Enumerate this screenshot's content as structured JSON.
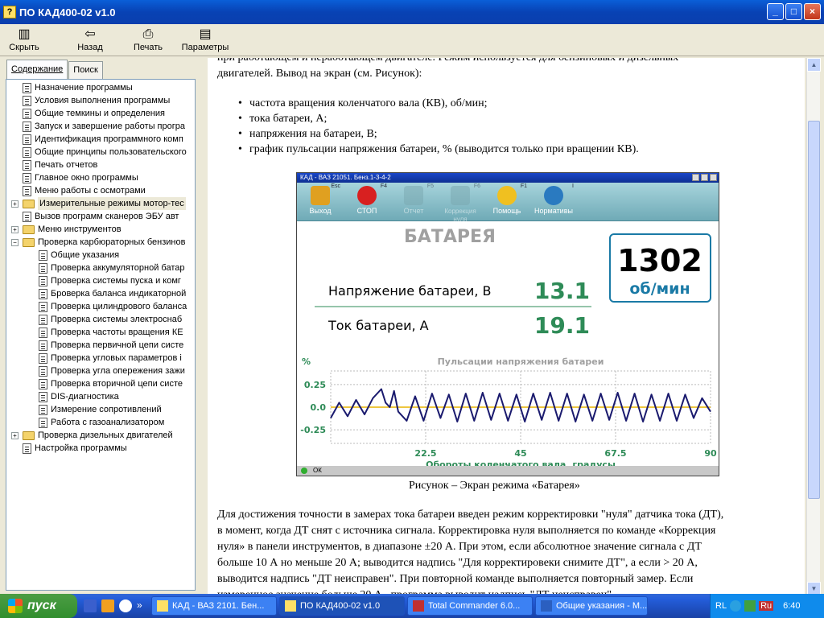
{
  "window": {
    "title": "ПО КАД400-02 v1.0",
    "controls": {
      "minimize": "_",
      "maximize": "□",
      "close": "×"
    }
  },
  "toolbar": [
    {
      "label": "Скрыть",
      "icon": "hide-icon"
    },
    {
      "label": "Назад",
      "icon": "back-arrow-icon"
    },
    {
      "label": "Печать",
      "icon": "printer-icon"
    },
    {
      "label": "Параметры",
      "icon": "options-icon"
    }
  ],
  "nav_tabs": [
    "Содержание",
    "Поиск"
  ],
  "tree": [
    {
      "label": "Назначение программы",
      "type": "doc",
      "level": 1
    },
    {
      "label": "Условия выполнения программы",
      "type": "doc",
      "level": 1
    },
    {
      "label": "Общие темкины и определения",
      "type": "doc",
      "level": 1
    },
    {
      "label": "Запуск и завершение работы програ",
      "type": "doc",
      "level": 1
    },
    {
      "label": "Идентификация программного комп",
      "type": "doc",
      "level": 1
    },
    {
      "label": "Общие принципы пользовательского",
      "type": "doc",
      "level": 1
    },
    {
      "label": "Печать отчетов",
      "type": "doc",
      "level": 1
    },
    {
      "label": "Главное окно программы",
      "type": "doc",
      "level": 1
    },
    {
      "label": "Меню работы с осмотрами",
      "type": "doc",
      "level": 1
    },
    {
      "label": "Измерительные режимы мотор-тес",
      "type": "folder",
      "level": 0,
      "toggle": "+",
      "highlight": true
    },
    {
      "label": "Вызов программ сканеров ЭБУ авт",
      "type": "doc",
      "level": 1
    },
    {
      "label": "Меню инструментов",
      "type": "folder",
      "level": 0,
      "toggle": "+"
    },
    {
      "label": "Проверка карбюраторных бензинов",
      "type": "folder-open",
      "level": 0,
      "toggle": "−"
    },
    {
      "label": "Общие указания",
      "type": "doc",
      "level": 2
    },
    {
      "label": "Проверка аккумуляторной батар",
      "type": "doc",
      "level": 2
    },
    {
      "label": "Проверка системы пуска и комг",
      "type": "doc",
      "level": 2
    },
    {
      "label": "Броверка баланса индикаторной",
      "type": "doc",
      "level": 2
    },
    {
      "label": "Проверка цилиндрового баланса",
      "type": "doc",
      "level": 2
    },
    {
      "label": "Проверка системы электроснаб",
      "type": "doc",
      "level": 2
    },
    {
      "label": "Проверка частоты вращения КЕ",
      "type": "doc",
      "level": 2
    },
    {
      "label": "Проверка первичной цепи систе",
      "type": "doc",
      "level": 2
    },
    {
      "label": "Проверка угловых параметров і",
      "type": "doc",
      "level": 2
    },
    {
      "label": "Проверка угла опережения зажи",
      "type": "doc",
      "level": 2
    },
    {
      "label": "Проверка вторичной цепи систе",
      "type": "doc",
      "level": 2
    },
    {
      "label": "DIS-диагностика",
      "type": "doc",
      "level": 2
    },
    {
      "label": "Измерение сопротивлений",
      "type": "doc",
      "level": 2
    },
    {
      "label": "Работа с газоанализатором",
      "type": "doc",
      "level": 2
    },
    {
      "label": "Проверка дизельных двигателей",
      "type": "folder",
      "level": 0,
      "toggle": "+"
    },
    {
      "label": "Настройка программы",
      "type": "doc",
      "level": 1
    }
  ],
  "content": {
    "intro_line1": "при работающем и неработающем двигателе. Режим используется для бензиновых и дизельных",
    "intro_line2": "двигателей. Вывод на экран (см. Рисунок):",
    "bullets": [
      "частота вращения коленчатого вала (КВ), об/мин;",
      "тока батареи, А;",
      "напряжения на батареи, В;",
      "график пульсации напряжения батареи, % (выводится только при вращении КВ)."
    ],
    "caption": "Рисунок – Экран режима «Батарея»",
    "para": [
      "Для достижения точности в замерах тока батареи введен режим корректировки \"нуля\" датчика тока (ДТ),",
      "в момент, когда ДТ снят с источника сигнала. Корректировка нуля выполняется по команде «Коррекция",
      "нуля» в панели инструментов, в диапазоне ±20 А. При этом, если абсолютное значение сигнала с ДТ",
      "больше 10 А но меньше 20 А; выводится надпись \"Для корректировеки снимите ДТ\", а если > 20 А,",
      "выводится надпись \"ДТ неисправен\". При повторной команде выполняется повторный замер. Если",
      "измеренное значение больше 20 А , программа выводит надпись \"ДТ неисправен\"."
    ]
  },
  "figure": {
    "title": "КАД - ВАЗ 21051. Бенз.1-3-4-2",
    "buttons": [
      {
        "label": "Выход",
        "key": "Esc",
        "icon": "exit-door-icon",
        "color": "#e0a020",
        "dim": false
      },
      {
        "label": "СТОП",
        "key": "F4",
        "icon": "stop-sign-icon",
        "color": "#d82020",
        "dim": false
      },
      {
        "label": "Отчет",
        "key": "F5",
        "icon": "report-icon",
        "color": "#7aa8b0",
        "dim": true
      },
      {
        "label": "Коррекция нуля",
        "key": "F6",
        "icon": "zero-correction-icon",
        "color": "#7aa8b0",
        "dim": true
      },
      {
        "label": "Помощь",
        "key": "F1",
        "icon": "help-icon",
        "color": "#f0c020",
        "dim": false
      },
      {
        "label": "Нормативы",
        "key": "I",
        "icon": "info-icon",
        "color": "#2a7ac0",
        "dim": false
      }
    ],
    "mode_title": "БАТАРЕЯ",
    "voltage_label": "Напряжение батареи, В",
    "voltage_value": "13.1",
    "current_label": "Ток батареи, А",
    "current_value": "19.1",
    "rpm_value": "1302",
    "rpm_unit": "об/мин",
    "status": "ОК",
    "value_color": "#2e8b57",
    "rpm_color": "#1a7aa6"
  },
  "chart_data": {
    "type": "line",
    "title": "Пульсации напряжения батареи",
    "ylabel": "%",
    "xlabel": "Обороты коленчатого вала, градусы",
    "xlim": [
      0,
      90
    ],
    "ylim": [
      -0.4,
      0.4
    ],
    "x_ticks": [
      "22.5",
      "45",
      "67.5",
      "90"
    ],
    "y_ticks": [
      "0.25",
      "0.0",
      "-0.25"
    ],
    "grid": true,
    "series": [
      {
        "color": "#1a1a6e",
        "x": [
          0,
          2,
          4,
          6,
          8,
          10,
          12,
          13,
          14,
          15,
          16,
          18,
          20,
          22,
          24,
          26,
          28,
          30,
          32,
          34,
          36,
          38,
          40,
          42,
          44,
          46,
          48,
          50,
          52,
          54,
          56,
          58,
          60,
          62,
          64,
          66,
          68,
          70,
          72,
          74,
          76,
          78,
          80,
          82,
          84,
          86,
          88,
          90
        ],
        "y": [
          -0.12,
          0.05,
          -0.1,
          0.08,
          -0.08,
          0.1,
          0.2,
          0.05,
          0.0,
          0.18,
          -0.05,
          -0.15,
          0.12,
          -0.15,
          0.15,
          -0.12,
          0.14,
          -0.16,
          0.15,
          -0.15,
          0.16,
          -0.14,
          0.15,
          -0.15,
          0.14,
          -0.16,
          0.15,
          -0.14,
          0.16,
          -0.15,
          0.15,
          -0.16,
          0.14,
          -0.15,
          0.15,
          -0.14,
          0.16,
          -0.15,
          0.15,
          -0.16,
          0.14,
          -0.15,
          0.15,
          -0.15,
          0.14,
          -0.12,
          0.1,
          -0.05
        ]
      }
    ]
  },
  "taskbar": {
    "start": "пуск",
    "tasks": [
      {
        "label": "КАД - ВАЗ 2101. Бен...",
        "active": false
      },
      {
        "label": "ПО КАД400-02 v1.0",
        "active": true
      },
      {
        "label": "Total Commander 6.0...",
        "active": false
      },
      {
        "label": "Общие указания - M...",
        "active": false
      }
    ],
    "lang": "RL",
    "lang2": "Ru",
    "clock": "6:40"
  }
}
